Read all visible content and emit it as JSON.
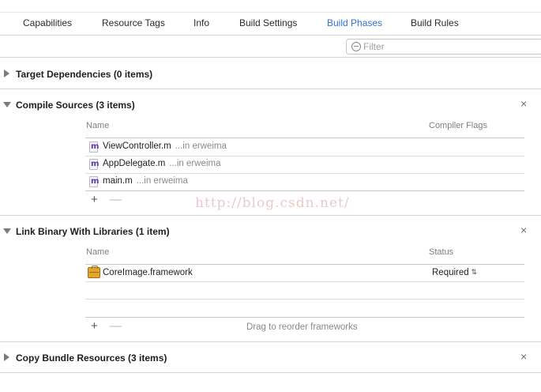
{
  "tabs": [
    {
      "label": "Capabilities",
      "active": false
    },
    {
      "label": "Resource Tags",
      "active": false
    },
    {
      "label": "Info",
      "active": false
    },
    {
      "label": "Build Settings",
      "active": false
    },
    {
      "label": "Build Phases",
      "active": true
    },
    {
      "label": "Build Rules",
      "active": false
    }
  ],
  "filter": {
    "placeholder": "Filter",
    "value": ""
  },
  "phases": {
    "target_dependencies": {
      "title": "Target Dependencies (0 items)",
      "expanded": false
    },
    "compile_sources": {
      "title": "Compile Sources (3 items)",
      "expanded": true,
      "columns": {
        "name": "Name",
        "flags": "Compiler Flags"
      },
      "files": [
        {
          "icon_label": "m",
          "name": "ViewController.m",
          "location": "...in erweima"
        },
        {
          "icon_label": "m",
          "name": "AppDelegate.m",
          "location": "...in erweima"
        },
        {
          "icon_label": "m",
          "name": "main.m",
          "location": "...in erweima"
        }
      ],
      "add_label": "+",
      "remove_label": "—"
    },
    "link_binary": {
      "title": "Link Binary With Libraries (1 item)",
      "expanded": true,
      "columns": {
        "name": "Name",
        "status": "Status"
      },
      "libraries": [
        {
          "name": "CoreImage.framework",
          "status": "Required"
        }
      ],
      "add_label": "+",
      "remove_label": "—",
      "drag_hint": "Drag to reorder frameworks"
    },
    "copy_bundle": {
      "title": "Copy Bundle Resources (3 items)",
      "expanded": false
    }
  },
  "close_label": "×",
  "watermark": "http://blog.csdn.net/",
  "colors": {
    "accent": "#2f73d9",
    "separator": "#d9d9d9",
    "secondary_text": "#8a8a8a"
  }
}
